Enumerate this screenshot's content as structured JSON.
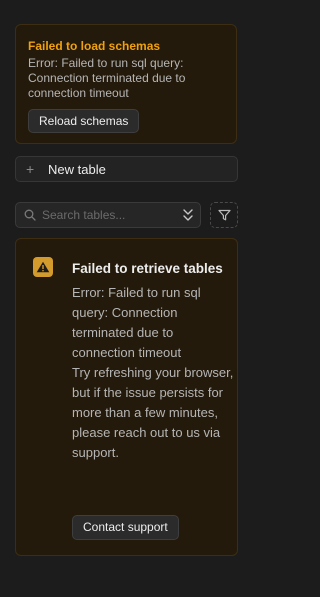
{
  "schema_warning": {
    "title": "Failed to load schemas",
    "message": "Error: Failed to run sql query: Connection terminated due to connection timeout",
    "reload_label": "Reload schemas"
  },
  "new_table": {
    "label": "New table",
    "icon": "plus-icon"
  },
  "search": {
    "placeholder": "Search tables...",
    "icon": "search-icon",
    "sort_icon": "chevron-up-down-icon"
  },
  "filter": {
    "icon": "filter-icon"
  },
  "tables_error": {
    "icon": "warning-icon",
    "title": "Failed to retrieve tables",
    "message": "Error: Failed to run sql query: Connection terminated due to connection timeout",
    "hint": "Try refreshing your browser, but if the issue persists for more than a few minutes, please reach out to us via support.",
    "contact_label": "Contact support"
  },
  "colors": {
    "warning_accent": "#f1a10d",
    "panel_bg": "#241a0b",
    "app_bg": "#1c1c1c"
  }
}
